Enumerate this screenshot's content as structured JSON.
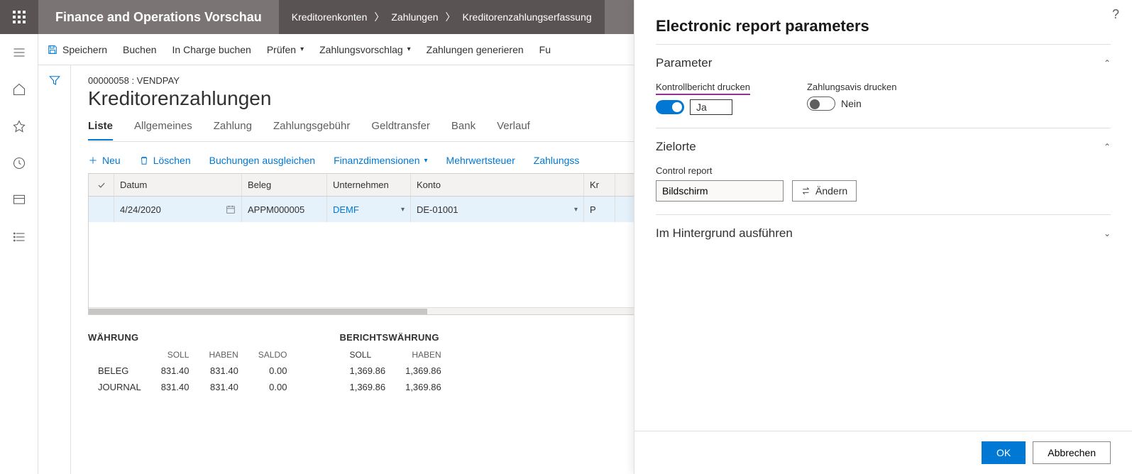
{
  "header": {
    "app_title": "Finance and Operations Vorschau",
    "breadcrumb": [
      "Kreditorenkonten",
      "Zahlungen",
      "Kreditorenzahlungserfassung"
    ]
  },
  "actionbar": {
    "save": "Speichern",
    "post": "Buchen",
    "post_in_charge": "In Charge buchen",
    "validate": "Prüfen",
    "payment_proposal": "Zahlungsvorschlag",
    "generate_payments": "Zahlungen generieren",
    "more": "Fu"
  },
  "page": {
    "journal_id": "00000058 : VENDPAY",
    "title": "Kreditorenzahlungen",
    "tabs": [
      "Liste",
      "Allgemeines",
      "Zahlung",
      "Zahlungsgebühr",
      "Geldtransfer",
      "Bank",
      "Verlauf"
    ]
  },
  "grid_tools": {
    "new": "Neu",
    "delete": "Löschen",
    "settle": "Buchungen ausgleichen",
    "fin_dim": "Finanzdimensionen",
    "vat": "Mehrwertsteuer",
    "pay_status": "Zahlungss"
  },
  "grid": {
    "headers": {
      "date": "Datum",
      "voucher": "Beleg",
      "company": "Unternehmen",
      "account": "Konto",
      "rest": "Kr"
    },
    "rows": [
      {
        "date": "4/24/2020",
        "voucher": "APPM000005",
        "company": "DEMF",
        "account": "DE-01001",
        "rest": "P"
      }
    ]
  },
  "totals": {
    "currency": {
      "title": "WÄHRUNG",
      "cols": [
        "SOLL",
        "HABEN",
        "SALDO"
      ],
      "rows": [
        {
          "label": "BELEG",
          "values": [
            "831.40",
            "831.40",
            "0.00"
          ]
        },
        {
          "label": "JOURNAL",
          "values": [
            "831.40",
            "831.40",
            "0.00"
          ]
        }
      ]
    },
    "reporting": {
      "title": "BERICHTSWÄHRUNG",
      "cols": [
        "SOLL",
        "HABEN"
      ],
      "rows": [
        {
          "values": [
            "1,369.86",
            "1,369.86"
          ]
        },
        {
          "values": [
            "1,369.86",
            "1,369.86"
          ]
        }
      ]
    }
  },
  "panel": {
    "title": "Electronic report parameters",
    "sections": {
      "parameter": {
        "title": "Parameter",
        "control_report_print_label": "Kontrollbericht drucken",
        "control_report_print_value": "Ja",
        "advice_print_label": "Zahlungsavis drucken",
        "advice_print_value": "Nein"
      },
      "destinations": {
        "title": "Zielorte",
        "control_report_label": "Control report",
        "control_report_value": "Bildschirm",
        "change_btn": "Ändern"
      },
      "background": {
        "title": "Im Hintergrund ausführen"
      }
    },
    "footer": {
      "ok": "OK",
      "cancel": "Abbrechen"
    }
  }
}
